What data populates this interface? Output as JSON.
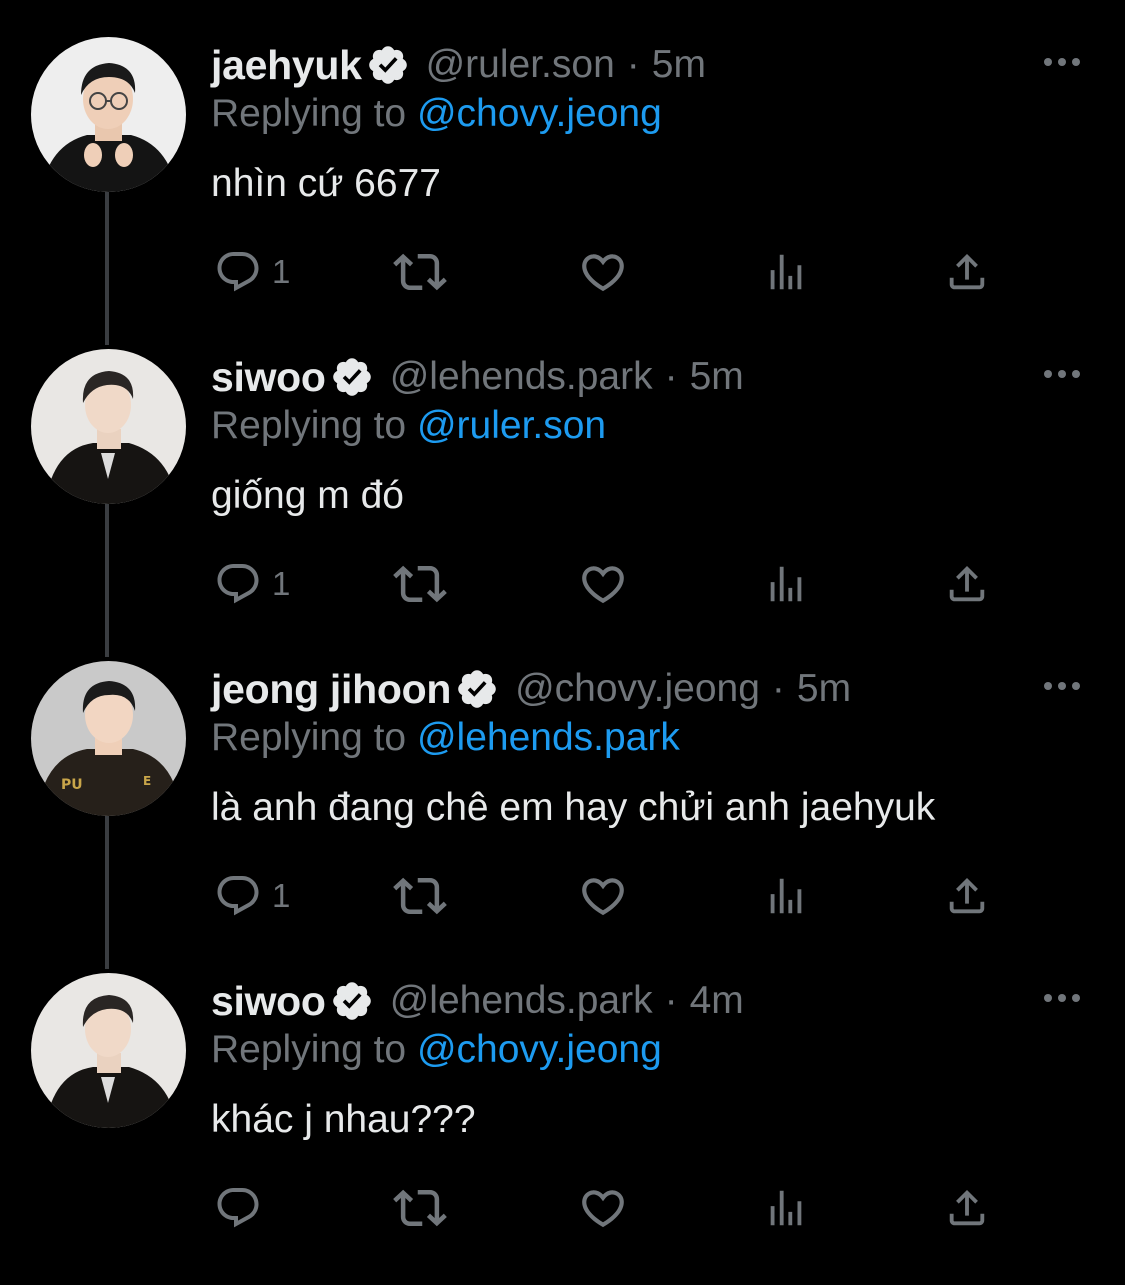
{
  "colors": {
    "background": "#000000",
    "text_primary": "#e7e9ea",
    "text_secondary": "#71767b",
    "accent": "#1d9bf0",
    "thread_line": "#3a3d41"
  },
  "tweets": [
    {
      "name": "jaehyuk",
      "handle": "@ruler.son",
      "separator": "·",
      "time": "5m",
      "reply_prefix": "Replying to ",
      "reply_to": "@chovy.jeong",
      "text": "nhìn cứ 6677",
      "reply_count": "1",
      "avatar_icon": "avatar-photo",
      "verified_icon": "verified-badge-icon"
    },
    {
      "name": "siwoo",
      "handle": "@lehends.park",
      "separator": "·",
      "time": "5m",
      "reply_prefix": "Replying to ",
      "reply_to": "@ruler.son",
      "text": "giống m đó",
      "reply_count": "1",
      "avatar_icon": "avatar-photo",
      "verified_icon": "verified-badge-icon"
    },
    {
      "name": "jeong jihoon",
      "handle": "@chovy.jeong",
      "separator": "·",
      "time": "5m",
      "reply_prefix": "Replying to ",
      "reply_to": "@lehends.park",
      "text": "là anh đang chê em hay chửi anh jaehyuk",
      "reply_count": "1",
      "avatar_icon": "avatar-photo",
      "verified_icon": "verified-badge-icon"
    },
    {
      "name": "siwoo",
      "handle": "@lehends.park",
      "separator": "·",
      "time": "4m",
      "reply_prefix": "Replying to ",
      "reply_to": "@chovy.jeong",
      "text": "khác j nhau???",
      "reply_count": "",
      "avatar_icon": "avatar-photo",
      "verified_icon": "verified-badge-icon"
    }
  ],
  "action_icons": [
    "reply-icon",
    "retweet-icon",
    "like-icon",
    "views-icon",
    "share-icon"
  ]
}
